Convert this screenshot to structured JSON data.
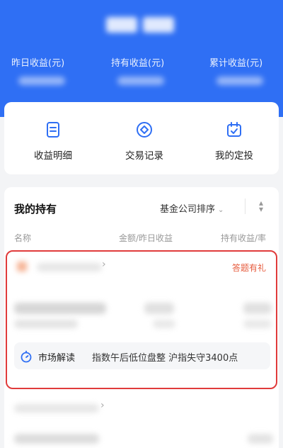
{
  "header": {
    "stats": [
      {
        "label": "昨日收益(元)"
      },
      {
        "label": "持有收益(元)"
      },
      {
        "label": "累计收益(元)"
      }
    ]
  },
  "quick_actions": [
    {
      "label": "收益明细",
      "icon": "document-icon"
    },
    {
      "label": "交易记录",
      "icon": "target-icon"
    },
    {
      "label": "我的定投",
      "icon": "calendar-icon"
    }
  ],
  "holdings": {
    "title": "我的持有",
    "sort_label": "基金公司排序",
    "sort_chevron": "⌄",
    "columns": [
      "名称",
      "金额/昨日收益",
      "持有收益/率"
    ],
    "highlighted_item": {
      "tag": "答题有礼",
      "insight_label": "市场解读",
      "insight_text": "指数午后低位盘整 沪指失守3400点"
    }
  },
  "colors": {
    "header_bg": "#2f6ff4",
    "accent_blue": "#2f6ff4",
    "tag_red": "#e65a3c",
    "highlight_border": "#e03b3b"
  }
}
